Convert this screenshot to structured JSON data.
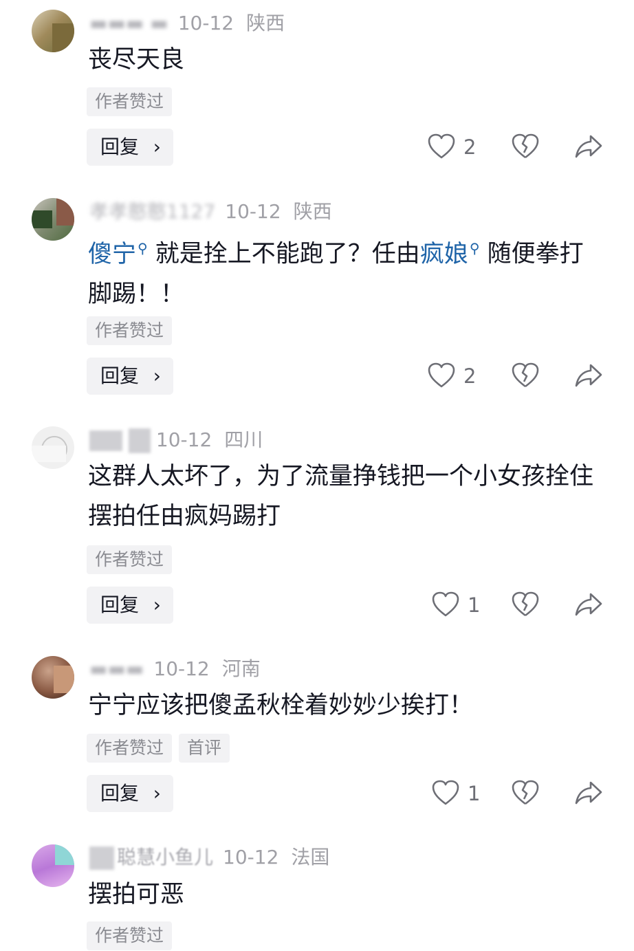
{
  "comments": [
    {
      "date": "10-12",
      "location": "陕西",
      "text": "丧尽天良",
      "tags": [
        "作者赞过"
      ],
      "reply_label": "回复",
      "like_count": "2"
    },
    {
      "name": "孝孝憨憨1127",
      "date": "10-12",
      "location": "陕西",
      "mention1": "傻宁",
      "text1": " 就是拴上不能跑了？任由",
      "mention2": "疯娘",
      "text2": " 随便拳打脚踢！！",
      "tags": [
        "作者赞过"
      ],
      "reply_label": "回复",
      "like_count": "2"
    },
    {
      "date": "10-12",
      "location": "四川",
      "text": "这群人太坏了，为了流量挣钱把一个小女孩拴住摆拍任由疯妈踢打",
      "tags": [
        "作者赞过"
      ],
      "reply_label": "回复",
      "like_count": "1"
    },
    {
      "date": "10-12",
      "location": "河南",
      "text": "宁宁应该把傻孟秋栓着妙妙少挨打！",
      "tags": [
        "作者赞过",
        "首评"
      ],
      "reply_label": "回复",
      "like_count": "1"
    },
    {
      "name": "聪慧小鱼儿",
      "date": "10-12",
      "location": "法国",
      "text": "摆拍可恶",
      "tags": [
        "作者赞过"
      ]
    }
  ]
}
